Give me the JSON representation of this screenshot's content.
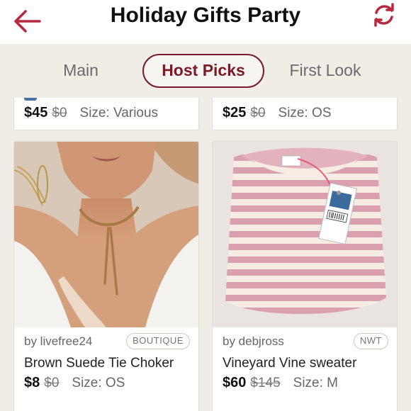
{
  "header": {
    "title": "Holiday Gifts Party",
    "back_icon": "back-arrow-icon",
    "refresh_icon": "refresh-icon",
    "accent": "#b5283d"
  },
  "tabs": [
    {
      "label": "Main",
      "active": false
    },
    {
      "label": "Host Picks",
      "active": true
    },
    {
      "label": "First Look",
      "active": false
    }
  ],
  "listings": [
    {
      "price": "$45",
      "original": "$0",
      "size": "Size: Various"
    },
    {
      "price": "$25",
      "original": "$0",
      "size": "Size: OS"
    },
    {
      "seller": "by livefree24",
      "badge": "BOUTIQUE",
      "title": "Brown Suede Tie Choker",
      "price": "$8",
      "original": "$0",
      "size": "Size: OS"
    },
    {
      "seller": "by debjross",
      "badge": "NWT",
      "title": "Vineyard Vine sweater",
      "price": "$60",
      "original": "$145",
      "size": "Size: M"
    }
  ]
}
